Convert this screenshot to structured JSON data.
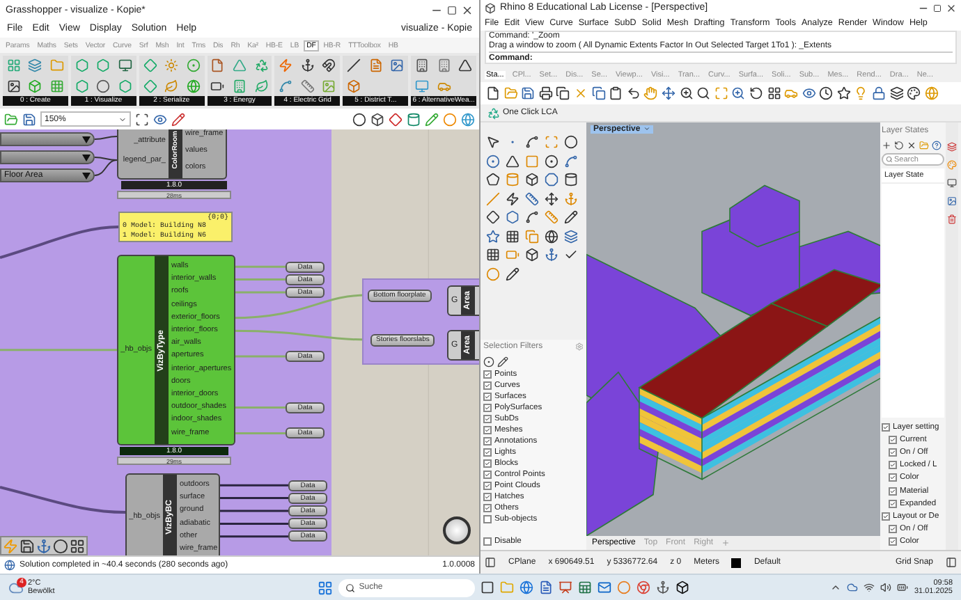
{
  "grasshopper": {
    "title": "Grasshopper - visualize - Kopie*",
    "menu": [
      "File",
      "Edit",
      "View",
      "Display",
      "Solution",
      "Help"
    ],
    "document": "visualize - Kopie",
    "tabs": [
      {
        "label": "Params",
        "selected": false
      },
      {
        "label": "Maths",
        "selected": false
      },
      {
        "label": "Sets",
        "selected": false
      },
      {
        "label": "Vector",
        "selected": false
      },
      {
        "label": "Curve",
        "selected": false
      },
      {
        "label": "Srf",
        "selected": false
      },
      {
        "label": "Msh",
        "selected": false
      },
      {
        "label": "Int",
        "selected": false
      },
      {
        "label": "Trns",
        "selected": false
      },
      {
        "label": "Dis",
        "selected": false
      },
      {
        "label": "Rh",
        "selected": false
      },
      {
        "label": "Ka²",
        "selected": false
      },
      {
        "label": "HB-E",
        "selected": false
      },
      {
        "label": "LB",
        "selected": false
      },
      {
        "label": "DF",
        "selected": true
      },
      {
        "label": "HB-R",
        "selected": false
      },
      {
        "label": "TTToolbox",
        "selected": false
      },
      {
        "label": "HB",
        "selected": false
      }
    ],
    "ribbon_groups": [
      "0 : Create",
      "1 : Visualize",
      "2 : Serialize",
      "3 : Energy",
      "4 : Electric Grid",
      "5 : District T...",
      "6 : AlternativeWea..."
    ],
    "zoom": "150%",
    "canvas": {
      "dropdowns": [
        {
          "kind": "dropdown"
        },
        {
          "kind": "dropdown"
        },
        {
          "kind": "dropdown",
          "value": "Floor Area"
        }
      ],
      "color_room": {
        "name": "ColorRoom",
        "inputs": [
          "_attribute",
          "legend_par_"
        ],
        "outputs": [
          "wire_frame",
          "values",
          "colors"
        ],
        "version": "1.8.0",
        "time": "28ms"
      },
      "panel": {
        "header": "{0;0}",
        "lines": [
          "0 Model: Building N8",
          "1 Model: Building N6"
        ]
      },
      "viz_by_type": {
        "name": "VizByType",
        "input": "_hb_objs",
        "version": "1.8.0",
        "time": "29ms",
        "outputs": [
          {
            "label": "walls",
            "preview": "Data"
          },
          {
            "label": "interior_walls",
            "preview": "Data"
          },
          {
            "label": "roofs",
            "preview": "Data"
          },
          {
            "label": "ceilings"
          },
          {
            "label": "exterior_floors",
            "linked": true
          },
          {
            "label": "interior_floors",
            "linked": true
          },
          {
            "label": "air_walls"
          },
          {
            "label": "apertures",
            "preview": "Data"
          },
          {
            "label": "interior_apertures"
          },
          {
            "label": "doors"
          },
          {
            "label": "interior_doors"
          },
          {
            "label": "outdoor_shades",
            "preview": "Data"
          },
          {
            "label": "indoor_shades"
          },
          {
            "label": "wire_frame",
            "preview": "Data"
          }
        ]
      },
      "group": [
        {
          "label": "Bottom floorplate",
          "node": "G",
          "node_name": "Area"
        },
        {
          "label": "Stories floorslabs",
          "node": "G",
          "node_name": "Area"
        }
      ],
      "viz_by_bc": {
        "name": "VizByBC",
        "input": "_hb_objs",
        "outputs": [
          {
            "label": "outdoors",
            "preview": "Data"
          },
          {
            "label": "surface",
            "preview": "Data"
          },
          {
            "label": "ground",
            "preview": "Data"
          },
          {
            "label": "adiabatic",
            "preview": "Data"
          },
          {
            "label": "other",
            "preview": "Data"
          },
          {
            "label": "wire_frame"
          }
        ]
      }
    },
    "status": "Solution completed in ~40.4 seconds (280 seconds ago)",
    "version": "1.0.0008"
  },
  "rhino": {
    "title": "Rhino 8 Educational Lab License - [Perspective]",
    "menu": [
      "File",
      "Edit",
      "View",
      "Curve",
      "Surface",
      "SubD",
      "Solid",
      "Mesh",
      "Drafting",
      "Transform",
      "Tools",
      "Analyze",
      "Render",
      "Window",
      "Help"
    ],
    "command_history": [
      "Command: '_Zoom",
      "Drag a window to zoom ( All  Dynamic  Extents  Factor  In  Out  Selected  Target  1To1 ): _Extents"
    ],
    "command_prompt": "Command:",
    "toolbar_tabs": [
      {
        "label": "Sta...",
        "selected": true
      },
      {
        "label": "CPl...",
        "selected": false
      },
      {
        "label": "Set...",
        "selected": false
      },
      {
        "label": "Dis...",
        "selected": false
      },
      {
        "label": "Se...",
        "selected": false
      },
      {
        "label": "Viewp...",
        "selected": false
      },
      {
        "label": "Visi...",
        "selected": false
      },
      {
        "label": "Tran...",
        "selected": false
      },
      {
        "label": "Curv...",
        "selected": false
      },
      {
        "label": "Surfa...",
        "selected": false
      },
      {
        "label": "Soli...",
        "selected": false
      },
      {
        "label": "Sub...",
        "selected": false
      },
      {
        "label": "Mes...",
        "selected": false
      },
      {
        "label": "Rend...",
        "selected": false
      },
      {
        "label": "Dra...",
        "selected": false
      },
      {
        "label": "Ne...",
        "selected": false
      }
    ],
    "plugin": "One Click LCA",
    "viewport": {
      "title": "Perspective",
      "tabs": [
        {
          "label": "Perspective",
          "selected": true
        },
        {
          "label": "Top",
          "selected": false
        },
        {
          "label": "Front",
          "selected": false
        },
        {
          "label": "Right",
          "selected": false
        }
      ]
    },
    "selection_filters": {
      "title": "Selection Filters",
      "items": [
        {
          "label": "Points",
          "checked": true
        },
        {
          "label": "Curves",
          "checked": true
        },
        {
          "label": "Surfaces",
          "checked": true
        },
        {
          "label": "PolySurfaces",
          "checked": true
        },
        {
          "label": "SubDs",
          "checked": true
        },
        {
          "label": "Meshes",
          "checked": true
        },
        {
          "label": "Annotations",
          "checked": true
        },
        {
          "label": "Lights",
          "checked": true
        },
        {
          "label": "Blocks",
          "checked": true
        },
        {
          "label": "Control Points",
          "checked": true
        },
        {
          "label": "Point Clouds",
          "checked": true
        },
        {
          "label": "Hatches",
          "checked": true
        },
        {
          "label": "Others",
          "checked": true
        },
        {
          "label": "Sub-objects",
          "checked": false
        }
      ],
      "disable": {
        "label": "Disable",
        "checked": false
      }
    },
    "layer_states": {
      "title": "Layer States",
      "search_placeholder": "Search",
      "column": "Layer State",
      "settings": [
        {
          "label": "Layer setting",
          "checked": true,
          "children": [
            {
              "label": "Current",
              "checked": true
            },
            {
              "label": "On / Off",
              "checked": true
            },
            {
              "label": "Locked / L",
              "checked": true
            },
            {
              "label": "Color",
              "checked": true
            },
            {
              "label": "Material",
              "checked": true
            },
            {
              "label": "Expanded",
              "checked": true
            }
          ]
        },
        {
          "label": "Layout or De",
          "checked": true,
          "children": [
            {
              "label": "On / Off",
              "checked": true
            },
            {
              "label": "Color",
              "checked": true
            }
          ]
        }
      ]
    },
    "status_bar": {
      "cplane": "CPlane",
      "x": "x 690649.51",
      "y": "y 5336772.64",
      "z": "z 0",
      "units": "Meters",
      "layer": "Default",
      "grid_snap": "Grid Snap"
    }
  },
  "taskbar": {
    "temperature": "2°C",
    "condition": "Bewölkt",
    "badge": "4",
    "search_placeholder": "Suche",
    "time": "09:58",
    "date": "31.01.2025"
  }
}
